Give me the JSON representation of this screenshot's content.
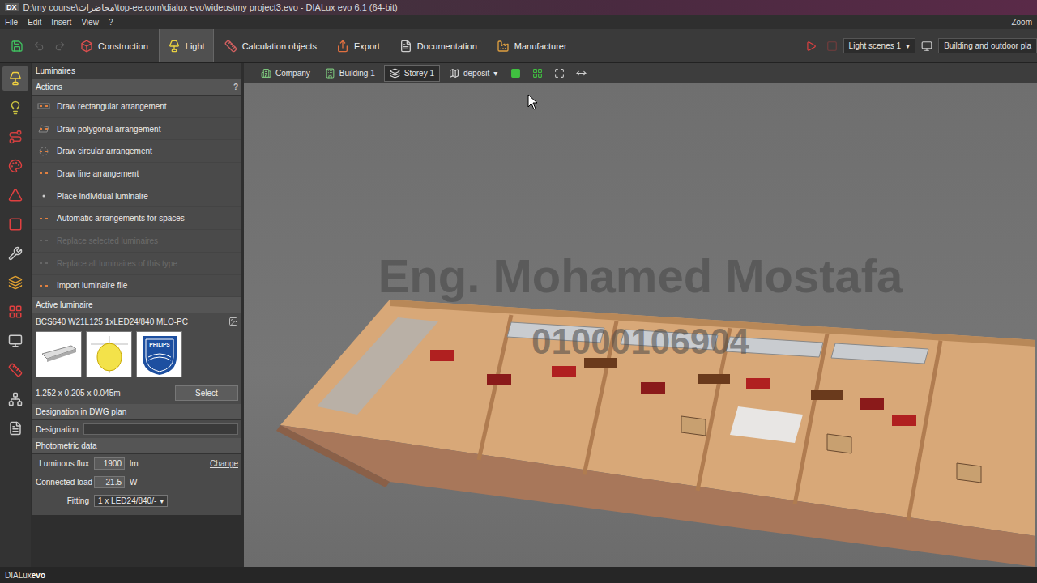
{
  "window": {
    "title": "D:\\my course\\محاضرات\\top-ee.com\\dialux evo\\videos\\my project3.evo - DIALux evo 6.1  (64-bit)",
    "app_letters": "DX"
  },
  "menu": [
    "File",
    "Edit",
    "Insert",
    "View",
    "?"
  ],
  "zoom_label": "Zoom",
  "toolbar": {
    "modes": [
      {
        "label": "Construction",
        "selected": false
      },
      {
        "label": "Light",
        "selected": true
      },
      {
        "label": "Calculation objects",
        "selected": false
      },
      {
        "label": "Export",
        "selected": false
      },
      {
        "label": "Documentation",
        "selected": false
      },
      {
        "label": "Manufacturer",
        "selected": false
      }
    ],
    "light_scene": "Light scenes 1",
    "arrow": "▾",
    "view_selector": "Building and outdoor pla"
  },
  "rail": [
    {
      "selected": true
    },
    {
      "selected": false
    },
    {
      "selected": false
    },
    {
      "selected": false
    },
    {
      "selected": false
    },
    {
      "selected": false
    },
    {
      "selected": false
    },
    {
      "selected": false
    },
    {
      "selected": false
    },
    {
      "selected": false
    },
    {
      "selected": false
    },
    {
      "selected": false
    },
    {
      "selected": false
    }
  ],
  "panel": {
    "title": "Luminaires",
    "actions_title": "Actions",
    "help": "?",
    "actions": [
      {
        "label": "Draw rectangular arrangement",
        "disabled": false
      },
      {
        "label": "Draw polygonal arrangement",
        "disabled": false
      },
      {
        "label": "Draw circular arrangement",
        "disabled": false
      },
      {
        "label": "Draw line arrangement",
        "disabled": false
      },
      {
        "label": "Place individual luminaire",
        "disabled": false
      },
      {
        "label": "Automatic arrangements for spaces",
        "disabled": false
      },
      {
        "label": "Replace selected luminaires",
        "disabled": true
      },
      {
        "label": "Replace all luminaires of this type",
        "disabled": true
      },
      {
        "label": "Import luminaire file",
        "disabled": false
      }
    ],
    "active_luminaire": {
      "title": "Active luminaire",
      "name": "BCS640 W21L125 1xLED24/840 MLO-PC",
      "manufacturer": "PHILIPS",
      "dimensions": "1.252 x 0.205 x 0.045m",
      "select_button": "Select"
    },
    "designation": {
      "title": "Designation in DWG plan",
      "label": "Designation",
      "value": ""
    },
    "photometric": {
      "title": "Photometric data",
      "flux_label": "Luminous flux",
      "flux": "1900",
      "flux_unit": "lm",
      "change": "Change",
      "load_label": "Connected load",
      "load": "21.5",
      "load_unit": "W",
      "fitting_label": "Fitting",
      "fitting": "1 x LED24/840/-",
      "arrow": "▾"
    }
  },
  "breadcrumb": [
    {
      "label": "Company",
      "selected": false
    },
    {
      "label": "Building 1",
      "selected": false
    },
    {
      "label": "Storey 1",
      "selected": true
    },
    {
      "label": "deposit",
      "selected": false
    }
  ],
  "breadcrumb_arrow": "▾",
  "watermark": [
    "Eng. Mohamed Mostafa",
    "01000106904"
  ],
  "status_bar": {
    "brand": "DIALux",
    "suffix": "evo"
  }
}
